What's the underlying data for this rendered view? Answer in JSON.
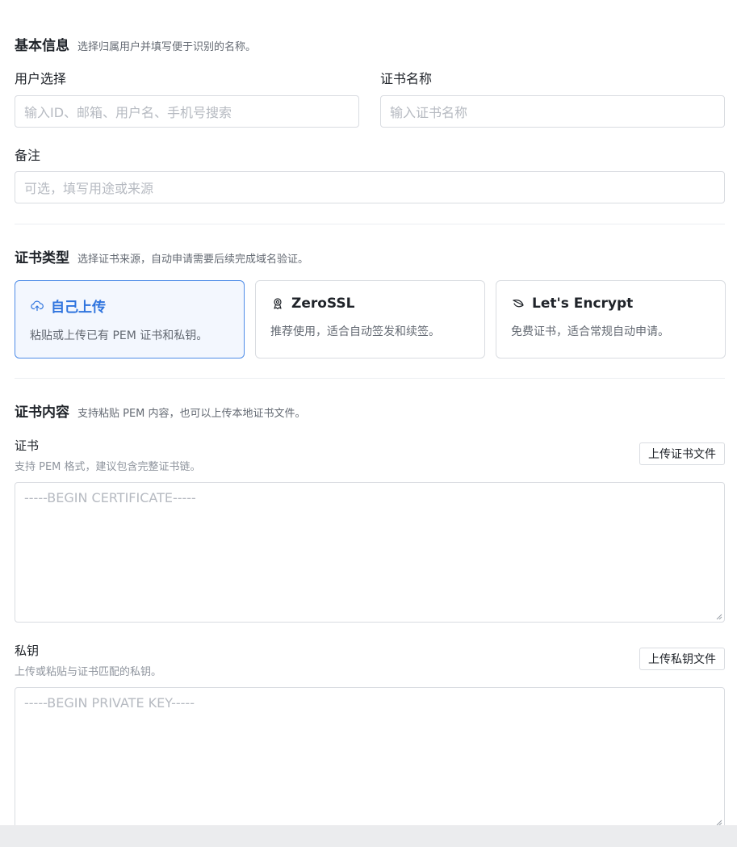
{
  "basic": {
    "title": "基本信息",
    "desc": "选择归属用户并填写便于识别的名称。",
    "user_label": "用户选择",
    "user_placeholder": "输入ID、邮箱、用户名、手机号搜索",
    "cert_name_label": "证书名称",
    "cert_name_placeholder": "输入证书名称",
    "remark_label": "备注",
    "remark_placeholder": "可选，填写用途或来源"
  },
  "cert_type": {
    "title": "证书类型",
    "desc": "选择证书来源，自动申请需要后续完成域名验证。",
    "options": [
      {
        "label": "自己上传",
        "desc": "粘贴或上传已有 PEM 证书和私钥。",
        "icon": "cloud-upload-icon",
        "selected": true
      },
      {
        "label": "ZeroSSL",
        "desc": "推荐使用，适合自动签发和续签。",
        "icon": "award-badge-icon",
        "selected": false
      },
      {
        "label": "Let's Encrypt",
        "desc": "免费证书，适合常规自动申请。",
        "icon": "leaf-icon",
        "selected": false
      }
    ],
    "accent_color": "#2f74de"
  },
  "content": {
    "title": "证书内容",
    "desc": "支持粘贴 PEM 内容，也可以上传本地证书文件。",
    "cert_label": "证书",
    "cert_hint": "支持 PEM 格式，建议包含完整证书链。",
    "cert_upload_label": "上传证书文件",
    "cert_placeholder": "-----BEGIN CERTIFICATE-----",
    "key_label": "私钥",
    "key_hint": "上传或粘贴与证书匹配的私钥。",
    "key_upload_label": "上传私钥文件",
    "key_placeholder": "-----BEGIN PRIVATE KEY-----"
  }
}
